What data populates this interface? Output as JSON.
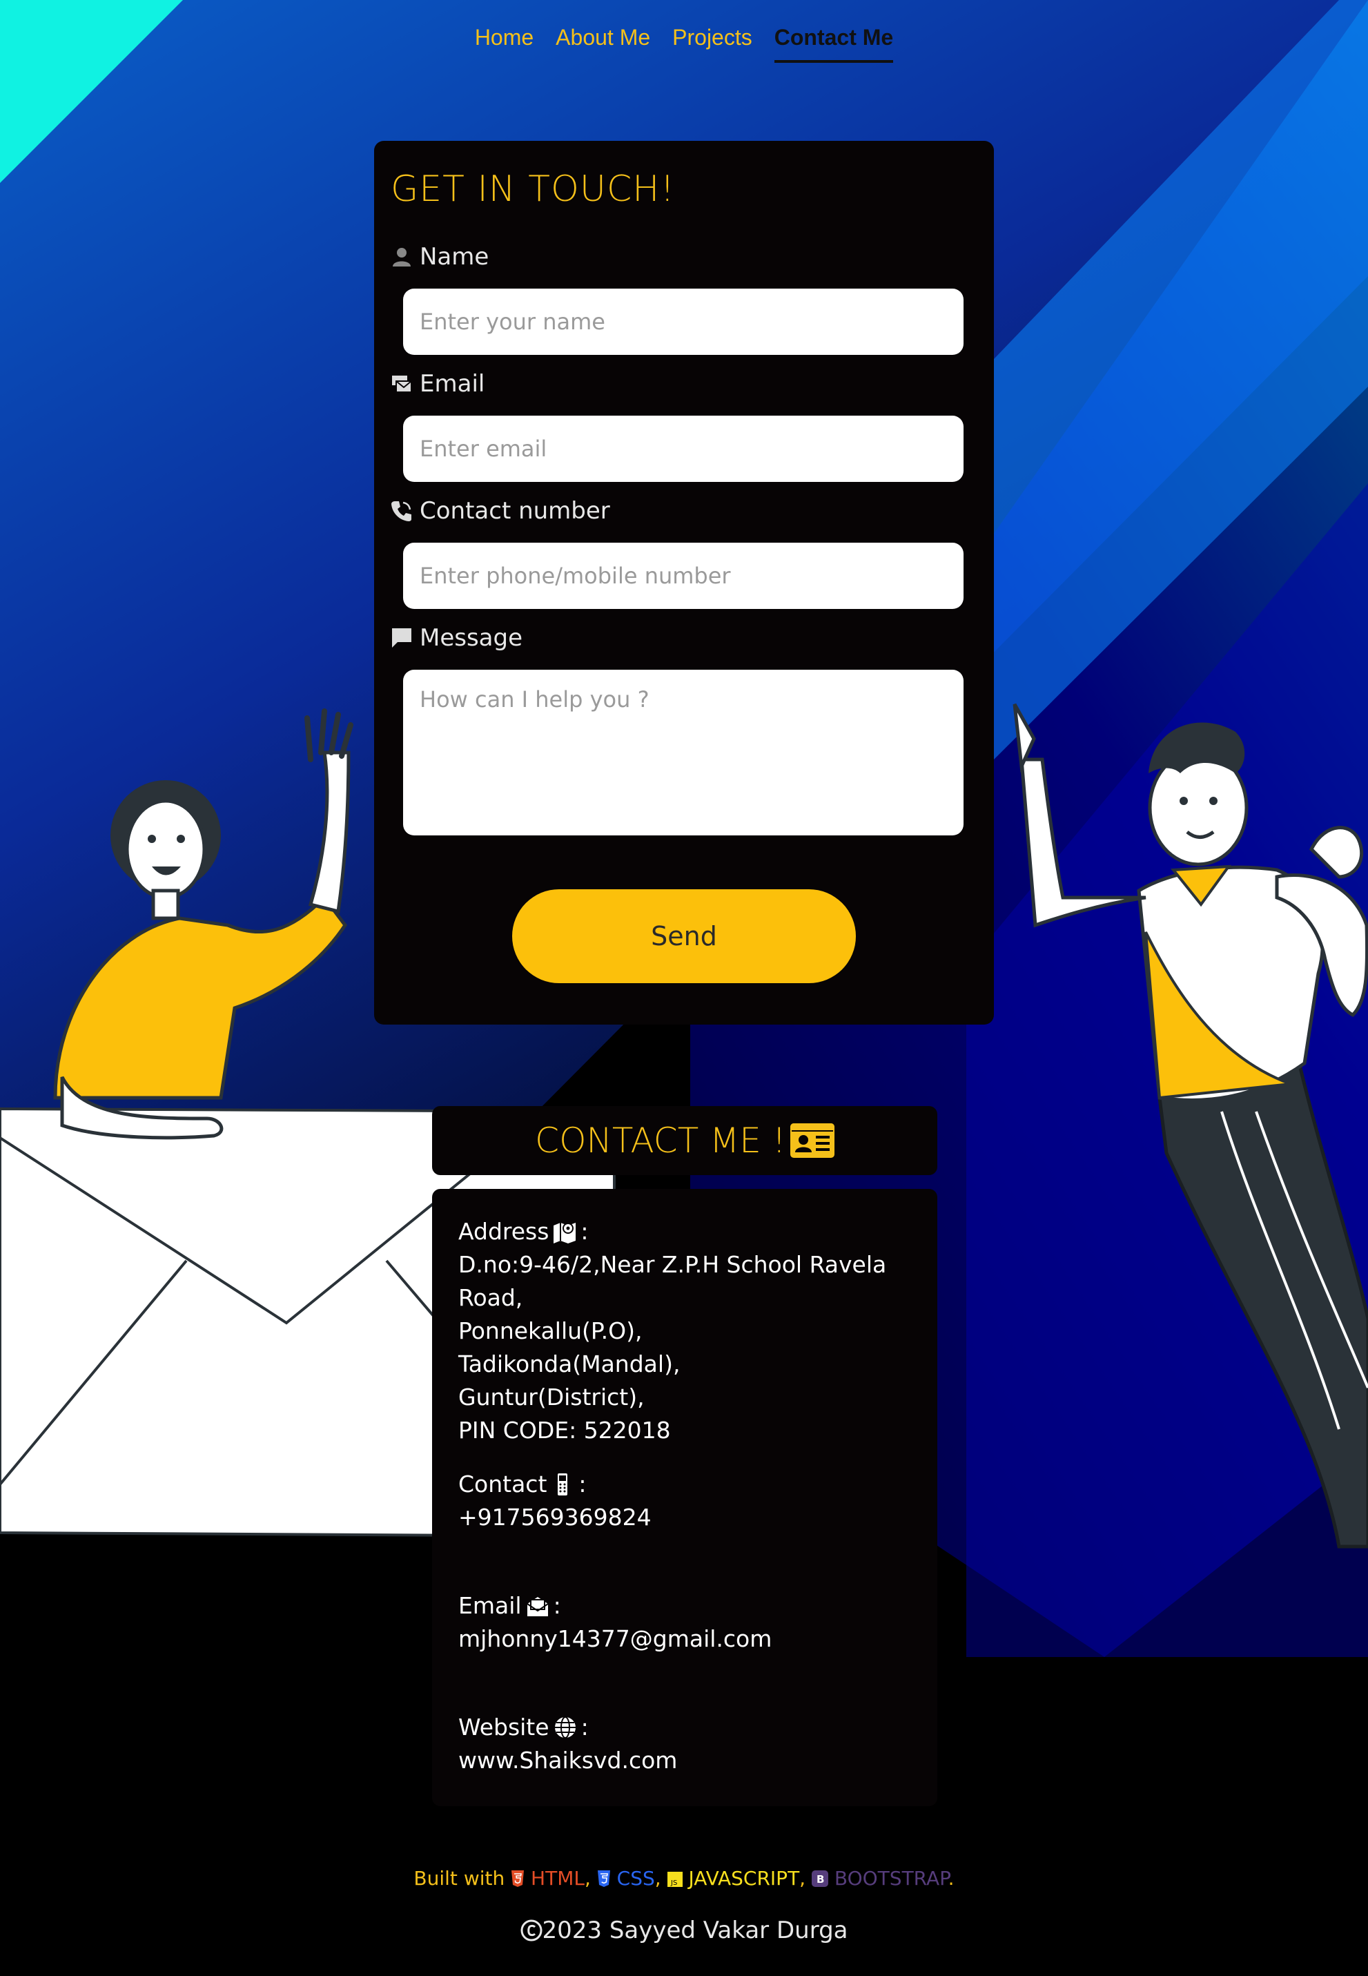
{
  "nav": {
    "items": [
      {
        "label": "Home",
        "active": false
      },
      {
        "label": "About Me",
        "active": false
      },
      {
        "label": "Projects",
        "active": false
      },
      {
        "label": "Contact Me",
        "active": true
      }
    ]
  },
  "form": {
    "title": "GET IN TOUCH!",
    "name_label": "Name",
    "name_placeholder": "Enter your name",
    "email_label": "Email",
    "email_placeholder": "Enter email",
    "contact_label": "Contact number",
    "contact_placeholder": "Enter phone/mobile number",
    "message_label": "Message",
    "message_placeholder": "How can I help you ?",
    "send_label": "Send"
  },
  "contact": {
    "title": "CONTACT ME !",
    "address_label": "Address",
    "address_lines": [
      "D.no:9-46/2,Near Z.P.H School Ravela Road,",
      "Ponnekallu(P.O),",
      "Tadikonda(Mandal),",
      "Guntur(District),",
      "PIN CODE: 522018"
    ],
    "phone_label": "Contact",
    "phone": "+917569369824",
    "email_label": "Email",
    "email": "mjhonny14377@gmail.com",
    "website_label": "Website",
    "website": "www.Shaiksvd.com"
  },
  "footer": {
    "built_with": "Built with",
    "techs": [
      {
        "name": "HTML",
        "color": "#e44d26"
      },
      {
        "name": "CSS",
        "color": "#2965f1"
      },
      {
        "name": "JAVASCRIPT",
        "color": "#f7df1e"
      },
      {
        "name": "BOOTSTRAP",
        "color": "#563d7c"
      }
    ],
    "copyright": "2023 Sayyed Vakar Durga"
  },
  "colors": {
    "accent": "#fcc00b",
    "card": "#070405"
  }
}
